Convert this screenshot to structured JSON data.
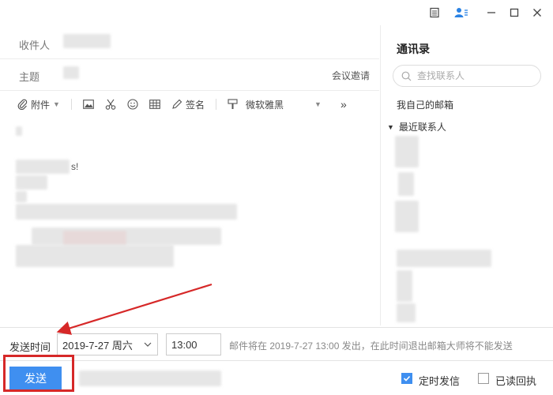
{
  "window": {
    "controls": [
      "notepad-icon",
      "contacts-toggle-icon",
      "minimize-icon",
      "maximize-icon",
      "close-icon"
    ]
  },
  "compose": {
    "to_label": "收件人",
    "subject_label": "主题",
    "meeting_invite": "会议邀请",
    "toolbar": {
      "attachment": "附件",
      "signature": "签名",
      "font": "微软雅黑"
    },
    "body_visible_text": "s!"
  },
  "contacts": {
    "title": "通讯录",
    "search_placeholder": "查找联系人",
    "my_mailbox": "我自己的邮箱",
    "recent": "最近联系人"
  },
  "schedule": {
    "label": "发送时间",
    "date": "2019-7-27 周六",
    "time": "13:00",
    "note": "邮件将在 2019-7-27 13:00 发出，在此时间退出邮箱大师将不能发送"
  },
  "send": {
    "button": "发送",
    "scheduled_send": "定时发信",
    "scheduled_checked": true,
    "read_receipt": "已读回执",
    "read_receipt_checked": false
  },
  "colors": {
    "accent": "#3f8ff0",
    "annotation_red": "#d62828"
  }
}
